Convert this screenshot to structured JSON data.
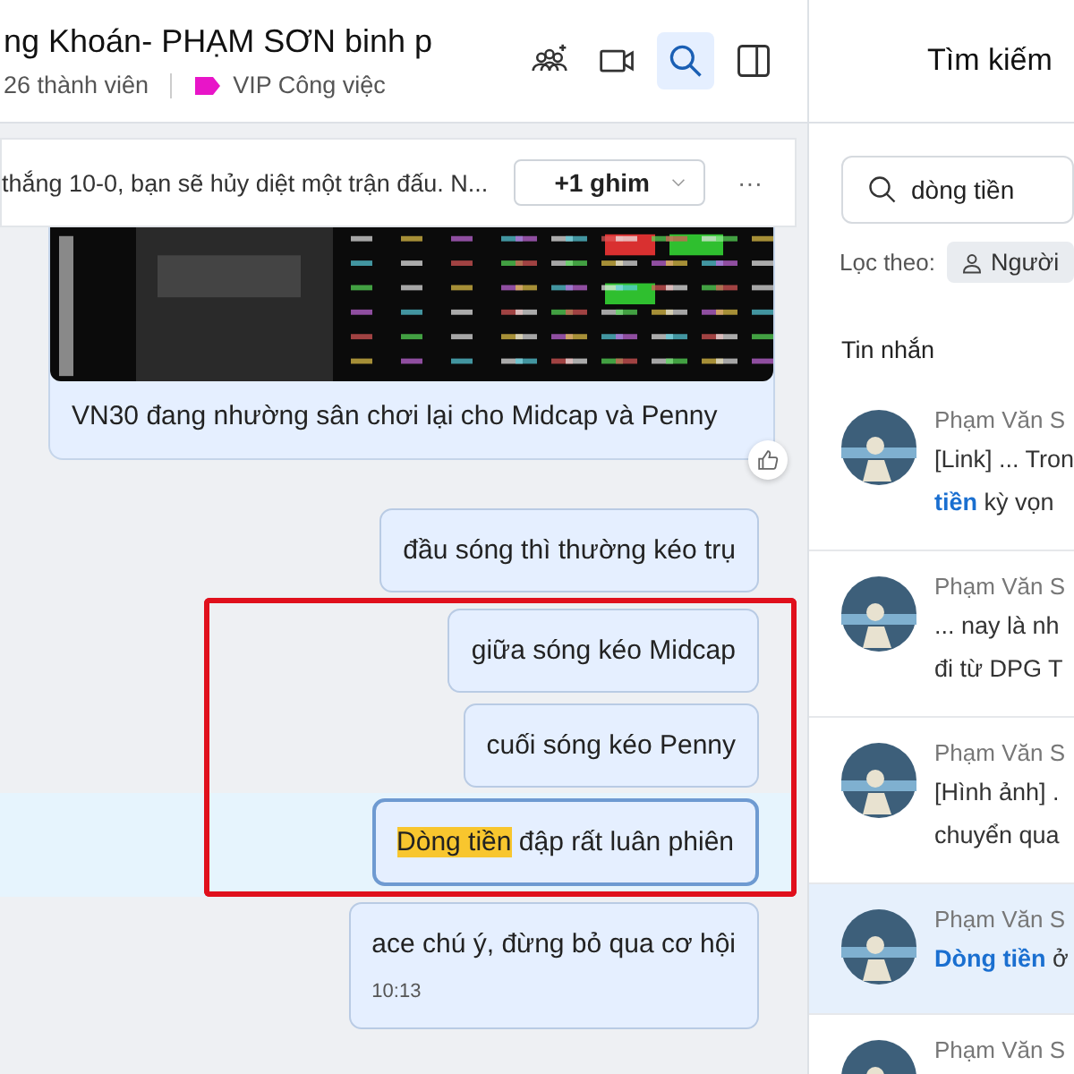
{
  "header": {
    "title": "ng Khoán- PHẠM SƠN binh p",
    "members": "26 thành viên",
    "label": {
      "text": "VIP Công việc",
      "color": "#e815c8"
    },
    "tools": [
      {
        "kind": "add-member",
        "selected": false
      },
      {
        "kind": "video",
        "selected": false
      },
      {
        "kind": "search",
        "selected": true
      },
      {
        "kind": "panel",
        "selected": false
      }
    ]
  },
  "pinned": {
    "text": "thắng 10-0, bạn sẽ hủy diệt một trận đấu. N...",
    "button": "+1 ghim",
    "more": "···"
  },
  "messages": [
    {
      "caption": "VN30 đang nhường sân chơi lại cho Midcap và Penny",
      "liked": false
    },
    {
      "kind": "text",
      "parts": [
        {
          "text": "đầu sóng thì thường kéo trụ",
          "match": false
        }
      ],
      "selected": false,
      "framed": false
    },
    {
      "kind": "text",
      "parts": [
        {
          "text": "giữa sóng kéo Midcap",
          "match": false
        }
      ],
      "selected": false,
      "framed": true
    },
    {
      "kind": "text",
      "parts": [
        {
          "text": "cuối sóng kéo Penny",
          "match": false
        }
      ],
      "selected": false,
      "framed": true
    },
    {
      "kind": "text",
      "parts": [
        {
          "text": "Dòng tiền",
          "match": true
        },
        {
          "text": " đập rất luân phiên",
          "match": false
        }
      ],
      "selected": true,
      "framed": true
    },
    {
      "kind": "text",
      "parts": [
        {
          "text": "ace chú ý, đừng bỏ qua cơ hội",
          "match": false
        }
      ],
      "time": "10:13",
      "selected": false,
      "framed": false
    }
  ],
  "search_panel": {
    "title": "Tìm kiếm",
    "query": "dòng tiền",
    "filter_label": "Lọc theo:",
    "filter_chip": "Người",
    "section": "Tin nhắn",
    "results": [
      {
        "author": "Phạm Văn S",
        "lines": [
          [
            {
              "text": "[Link] ... Tron",
              "match": false
            }
          ],
          [
            {
              "text": "tiền",
              "match": true
            },
            {
              "text": " kỳ vọn",
              "match": false
            }
          ]
        ],
        "selected": false
      },
      {
        "author": "Phạm Văn S",
        "lines": [
          [
            {
              "text": "... nay là nh",
              "match": false
            }
          ],
          [
            {
              "text": "đi từ DPG T",
              "match": false
            }
          ]
        ],
        "selected": false
      },
      {
        "author": "Phạm Văn S",
        "lines": [
          [
            {
              "text": "[Hình ảnh] .",
              "match": false
            }
          ],
          [
            {
              "text": "chuyển qua",
              "match": false
            }
          ]
        ],
        "selected": false
      },
      {
        "author": "Phạm Văn S",
        "lines": [
          [
            {
              "text": "Dòng tiền",
              "match": true
            },
            {
              "text": " ở",
              "match": false
            }
          ]
        ],
        "selected": true
      },
      {
        "author": "Phạm Văn S",
        "selected": false
      }
    ]
  }
}
